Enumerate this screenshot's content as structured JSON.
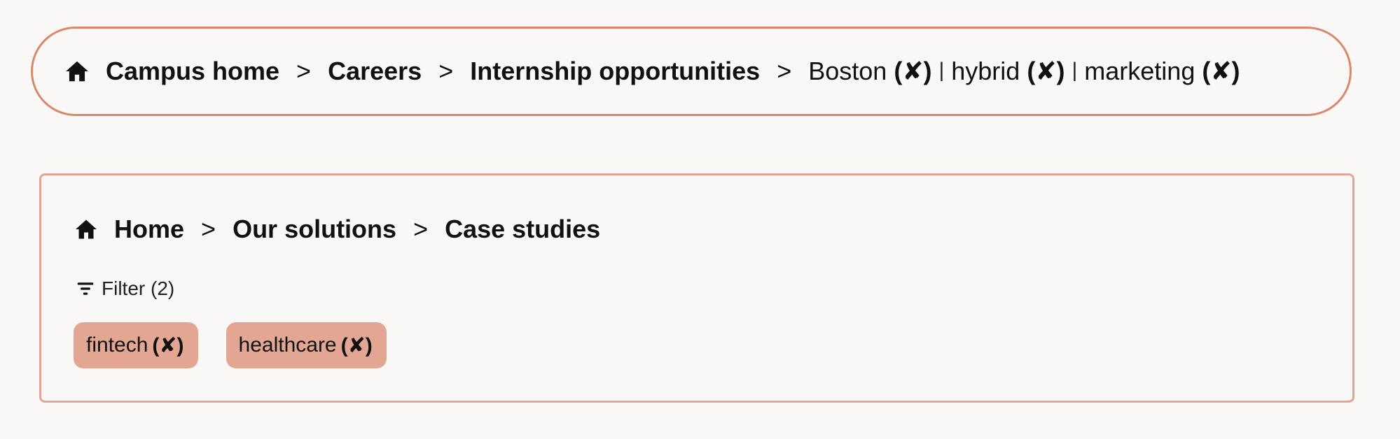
{
  "breadcrumb_primary": {
    "items": [
      {
        "label": "Campus home"
      },
      {
        "label": "Careers"
      },
      {
        "label": "Internship opportunities"
      }
    ],
    "separator": ">",
    "filters": [
      {
        "label": "Boston",
        "remove": "(✘)"
      },
      {
        "label": "hybrid",
        "remove": "(✘)"
      },
      {
        "label": "marketing",
        "remove": "(✘)"
      }
    ],
    "filter_divider": "|",
    "accent_color": "#d9896b"
  },
  "breadcrumb_secondary": {
    "items": [
      {
        "label": "Home"
      },
      {
        "label": "Our solutions"
      },
      {
        "label": "Case studies"
      }
    ],
    "separator": ">",
    "filter_toggle": "Filter (2)",
    "chips": [
      {
        "label": "fintech",
        "remove": "(✘)"
      },
      {
        "label": "healthcare",
        "remove": "(✘)"
      }
    ],
    "chip_color": "#e3a693",
    "border_color": "#e2a595"
  },
  "icons": {
    "home": "home-icon",
    "filter": "filter-icon"
  }
}
